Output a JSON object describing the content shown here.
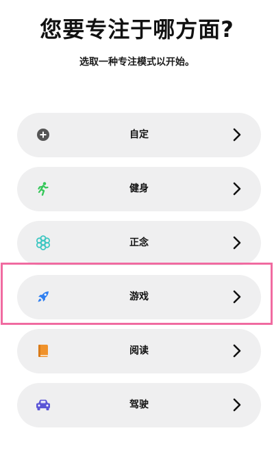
{
  "header": {
    "title": "您要专注于哪方面?",
    "subtitle": "选取一种专注模式以开始。"
  },
  "modes": [
    {
      "label": "自定",
      "icon": "plus-circle-icon",
      "color": "#555555"
    },
    {
      "label": "健身",
      "icon": "running-person-icon",
      "color": "#35c759"
    },
    {
      "label": "正念",
      "icon": "mindfulness-flower-icon",
      "color": "#3fc7c2"
    },
    {
      "label": "游戏",
      "icon": "rocket-icon",
      "color": "#2f7ff0"
    },
    {
      "label": "阅读",
      "icon": "book-icon",
      "color": "#f0922b"
    },
    {
      "label": "驾驶",
      "icon": "car-icon",
      "color": "#5b55d6"
    }
  ],
  "highlight": {
    "item": "游戏",
    "color": "#f06aa0"
  }
}
